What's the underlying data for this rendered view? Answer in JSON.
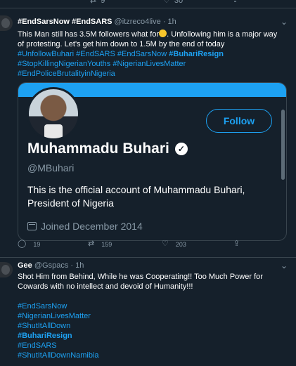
{
  "prev_actions": {
    "retweets": "9",
    "likes": "30"
  },
  "tweet1": {
    "name": "#EndSarsNow #EndSARS",
    "handle": "@itzreco4live",
    "time": "1h",
    "text_line1": "This Man still has 3.5M followers what for",
    "text_line1b": ". Unfollowing him is a major way",
    "text_line2": "of protesting. Let's get him down to 1.5M by the end of today",
    "tags_line3": [
      "#UnfollowBuhari",
      "#EndSARS",
      "#EndSarsNow",
      "#BuhariResign"
    ],
    "tags_line4": [
      "#StopKillingNigerianYouths",
      "#NigerianLivesMatter"
    ],
    "tags_line5": [
      "#EndPoliceBrutalityinNigeria"
    ],
    "card": {
      "name": "Muhammadu Buhari",
      "handle": "@MBuhari",
      "bio": "This is the official account of Muhammadu Buhari, President of Nigeria",
      "joined": "Joined December 2014",
      "follow_label": "Follow"
    },
    "actions": {
      "replies": "19",
      "retweets": "159",
      "likes": "203"
    }
  },
  "tweet2": {
    "name": "Gee",
    "handle": "@Gspacs",
    "time": "1h",
    "text": "Shot Him from Behind, While he was Cooperating!! Too Much Power for Cowards with no intellect and  devoid of Humanity!!!",
    "tags": [
      "#EndSarsNow",
      "#NigerianLivesMatter",
      "#ShutItAllDown",
      "#BuhariResign",
      "#EndSARS",
      "#ShutItAllDownNamibia"
    ]
  },
  "icons": {
    "reply": "reply-icon",
    "retweet": "retweet-icon",
    "like": "heart-icon",
    "share": "share-icon",
    "caret": "chevron-down-icon",
    "verified": "verified-badge-icon",
    "calendar": "calendar-icon"
  },
  "colors": {
    "background": "#15202b",
    "accent": "#1da1f2",
    "muted": "#8899a6",
    "border": "#38444d"
  }
}
